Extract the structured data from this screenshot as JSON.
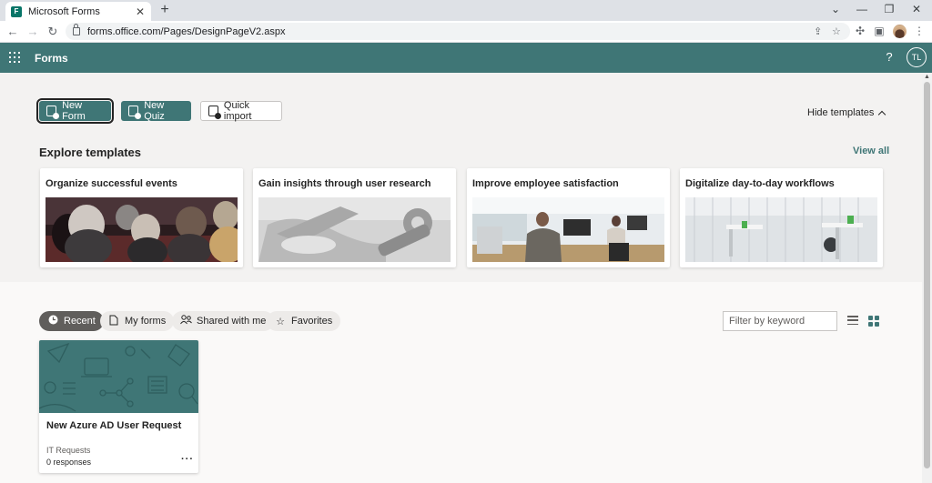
{
  "browser": {
    "tab_title": "Microsoft Forms",
    "url": "forms.office.com/Pages/DesignPageV2.aspx"
  },
  "app": {
    "name": "Forms",
    "user_initials": "TL",
    "accent_color": "#3f7676"
  },
  "actions": {
    "new_form": "New Form",
    "new_quiz": "New Quiz",
    "quick_import": "Quick import",
    "hide_templates": "Hide templates"
  },
  "templates": {
    "heading": "Explore templates",
    "view_all": "View all",
    "cards": [
      {
        "title": "Organize successful events"
      },
      {
        "title": "Gain insights through user research"
      },
      {
        "title": "Improve employee satisfaction"
      },
      {
        "title": "Digitalize day-to-day workflows"
      }
    ]
  },
  "filters": {
    "tabs": [
      {
        "label": "Recent",
        "icon": "clock-icon"
      },
      {
        "label": "My forms",
        "icon": "document-icon"
      },
      {
        "label": "Shared with me",
        "icon": "people-icon"
      },
      {
        "label": "Favorites",
        "icon": "star-icon"
      }
    ],
    "active_tab": "Recent",
    "search_placeholder": "Filter by keyword",
    "view_mode": "grid"
  },
  "forms": [
    {
      "title": "New Azure AD User Request",
      "group": "IT Requests",
      "responses": "0 responses",
      "more": "···"
    }
  ]
}
